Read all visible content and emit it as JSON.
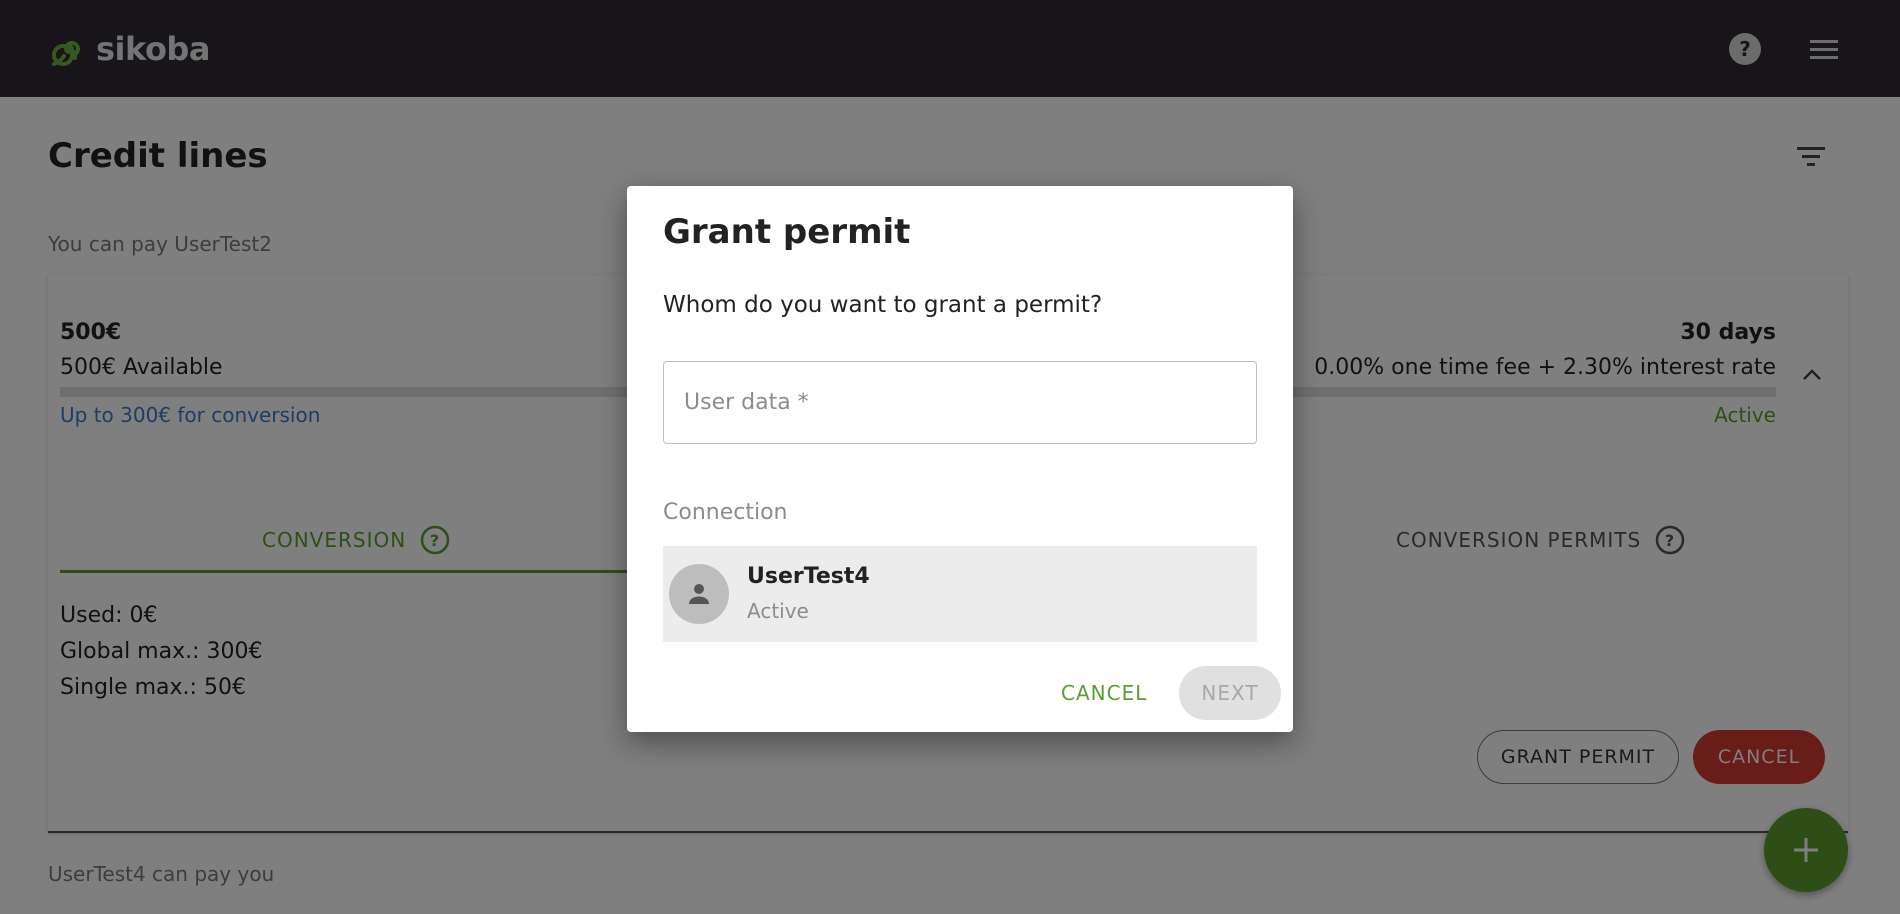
{
  "app": {
    "logo_text": "sikoba"
  },
  "page": {
    "title": "Credit lines",
    "section_pay_label": "You can pay UserTest2",
    "section_receive_label": "UserTest4 can pay you"
  },
  "credit_line": {
    "amount": "500€",
    "available": "500€ Available",
    "conversion_link": "Up to 300€ for conversion",
    "term": "30 days",
    "fees": "0.00% one time fee + 2.30% interest rate",
    "status": "Active",
    "tabs": [
      {
        "label": "CONVERSION"
      },
      {
        "label": "CONVERSION PERMITS"
      }
    ],
    "info": {
      "used": "Used: 0€",
      "global_max": "Global max.: 300€",
      "single_max": "Single max.: 50€"
    },
    "grant_permit_label": "GRANT PERMIT",
    "cancel_label": "CANCEL"
  },
  "dialog": {
    "title": "Grant permit",
    "question": "Whom do you want to grant a permit?",
    "input_placeholder": "User data *",
    "input_value": "",
    "connection_label": "Connection",
    "connection": {
      "name": "UserTest4",
      "status": "Active"
    },
    "cancel_label": "CANCEL",
    "next_label": "NEXT"
  },
  "colors": {
    "topbar": "#2f2a33",
    "accent_green": "#5a9e2e",
    "danger_red": "#d03a30",
    "link_blue": "#3d7bc9"
  },
  "icons": {
    "logo": "spiral-logo-icon",
    "help": "help-icon",
    "menu": "menu-icon",
    "filter": "filter-icon",
    "chevron": "chevron-up-icon",
    "add": "plus-icon",
    "avatar": "person-icon"
  }
}
